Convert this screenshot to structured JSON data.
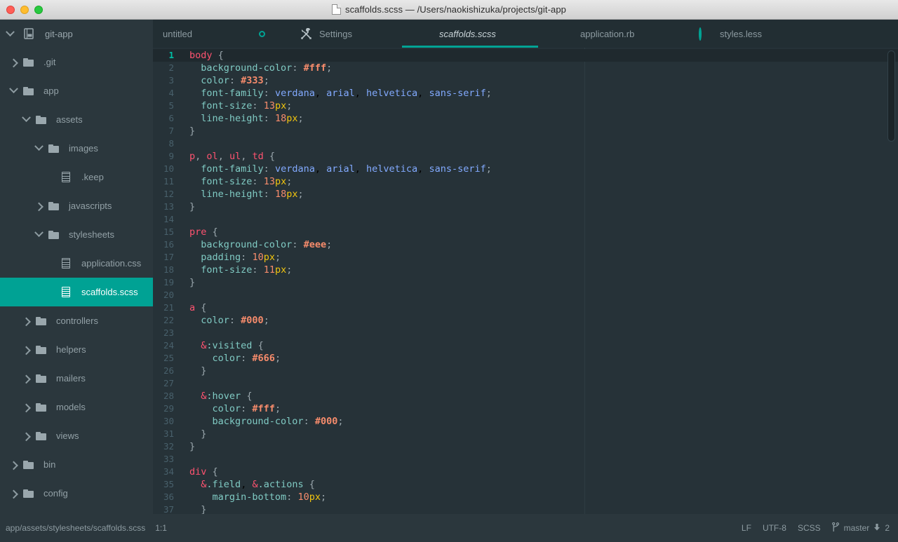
{
  "window": {
    "title": "scaffolds.scss — /Users/naokishizuka/projects/git-app",
    "traffic_lights": [
      "close",
      "minimize",
      "zoom"
    ],
    "title_icon": "document-icon"
  },
  "project": {
    "name": "git-app",
    "twisty": "chevron-down-icon",
    "icon": "project-book-icon"
  },
  "tabs": [
    {
      "label": "untitled",
      "active": false,
      "modified": true,
      "icon": null,
      "italic": false
    },
    {
      "label": "Settings",
      "active": false,
      "modified": false,
      "icon": "tools-icon",
      "italic": false
    },
    {
      "label": "scaffolds.scss",
      "active": true,
      "modified": false,
      "icon": null,
      "italic": true
    },
    {
      "label": "application.rb",
      "active": false,
      "modified": false,
      "icon": null,
      "italic": false
    },
    {
      "label": "styles.less",
      "active": false,
      "modified": true,
      "icon": null,
      "italic": false
    }
  ],
  "tree": [
    {
      "label": ".git",
      "type": "folder",
      "depth": 0,
      "twisty": "right",
      "selected": false
    },
    {
      "label": "app",
      "type": "folder",
      "depth": 0,
      "twisty": "down",
      "selected": false
    },
    {
      "label": "assets",
      "type": "folder",
      "depth": 1,
      "twisty": "down",
      "selected": false
    },
    {
      "label": "images",
      "type": "folder",
      "depth": 2,
      "twisty": "down",
      "selected": false
    },
    {
      "label": ".keep",
      "type": "file",
      "depth": 3,
      "twisty": "none",
      "selected": false
    },
    {
      "label": "javascripts",
      "type": "folder",
      "depth": 2,
      "twisty": "right",
      "selected": false
    },
    {
      "label": "stylesheets",
      "type": "folder",
      "depth": 2,
      "twisty": "down",
      "selected": false
    },
    {
      "label": "application.css",
      "type": "file",
      "depth": 3,
      "twisty": "none",
      "selected": false
    },
    {
      "label": "scaffolds.scss",
      "type": "file",
      "depth": 3,
      "twisty": "none",
      "selected": true
    },
    {
      "label": "controllers",
      "type": "folder",
      "depth": 1,
      "twisty": "right",
      "selected": false
    },
    {
      "label": "helpers",
      "type": "folder",
      "depth": 1,
      "twisty": "right",
      "selected": false
    },
    {
      "label": "mailers",
      "type": "folder",
      "depth": 1,
      "twisty": "right",
      "selected": false
    },
    {
      "label": "models",
      "type": "folder",
      "depth": 1,
      "twisty": "right",
      "selected": false
    },
    {
      "label": "views",
      "type": "folder",
      "depth": 1,
      "twisty": "right",
      "selected": false
    },
    {
      "label": "bin",
      "type": "folder",
      "depth": 0,
      "twisty": "right",
      "selected": false
    },
    {
      "label": "config",
      "type": "folder",
      "depth": 0,
      "twisty": "right",
      "selected": false
    }
  ],
  "editor": {
    "language": "SCSS",
    "cursor_line": 1,
    "lines": [
      {
        "n": 1,
        "text": "body {"
      },
      {
        "n": 2,
        "text": "  background-color: #fff;"
      },
      {
        "n": 3,
        "text": "  color: #333;"
      },
      {
        "n": 4,
        "text": "  font-family: verdana, arial, helvetica, sans-serif;"
      },
      {
        "n": 5,
        "text": "  font-size: 13px;"
      },
      {
        "n": 6,
        "text": "  line-height: 18px;"
      },
      {
        "n": 7,
        "text": "}"
      },
      {
        "n": 8,
        "text": ""
      },
      {
        "n": 9,
        "text": "p, ol, ul, td {"
      },
      {
        "n": 10,
        "text": "  font-family: verdana, arial, helvetica, sans-serif;"
      },
      {
        "n": 11,
        "text": "  font-size: 13px;"
      },
      {
        "n": 12,
        "text": "  line-height: 18px;"
      },
      {
        "n": 13,
        "text": "}"
      },
      {
        "n": 14,
        "text": ""
      },
      {
        "n": 15,
        "text": "pre {"
      },
      {
        "n": 16,
        "text": "  background-color: #eee;"
      },
      {
        "n": 17,
        "text": "  padding: 10px;"
      },
      {
        "n": 18,
        "text": "  font-size: 11px;"
      },
      {
        "n": 19,
        "text": "}"
      },
      {
        "n": 20,
        "text": ""
      },
      {
        "n": 21,
        "text": "a {"
      },
      {
        "n": 22,
        "text": "  color: #000;"
      },
      {
        "n": 23,
        "text": ""
      },
      {
        "n": 24,
        "text": "  &:visited {"
      },
      {
        "n": 25,
        "text": "    color: #666;"
      },
      {
        "n": 26,
        "text": "  }"
      },
      {
        "n": 27,
        "text": ""
      },
      {
        "n": 28,
        "text": "  &:hover {"
      },
      {
        "n": 29,
        "text": "    color: #fff;"
      },
      {
        "n": 30,
        "text": "    background-color: #000;"
      },
      {
        "n": 31,
        "text": "  }"
      },
      {
        "n": 32,
        "text": "}"
      },
      {
        "n": 33,
        "text": ""
      },
      {
        "n": 34,
        "text": "div {"
      },
      {
        "n": 35,
        "text": "  &.field, &.actions {"
      },
      {
        "n": 36,
        "text": "    margin-bottom: 10px;"
      },
      {
        "n": 37,
        "text": "  }"
      }
    ]
  },
  "status": {
    "path": "app/assets/stylesheets/scaffolds.scss",
    "cursor_position": "1:1",
    "line_ending": "LF",
    "encoding": "UTF-8",
    "grammar": "SCSS",
    "branch": "master",
    "branch_icon": "git-branch-icon",
    "pull_icon": "arrow-down-icon",
    "pull_count": "2"
  },
  "colors": {
    "accent": "#00a394",
    "selection": "#00a294",
    "editor_bg": "#263238",
    "sidebar_bg": "#2b373d",
    "tabbar_bg": "#222e33"
  }
}
